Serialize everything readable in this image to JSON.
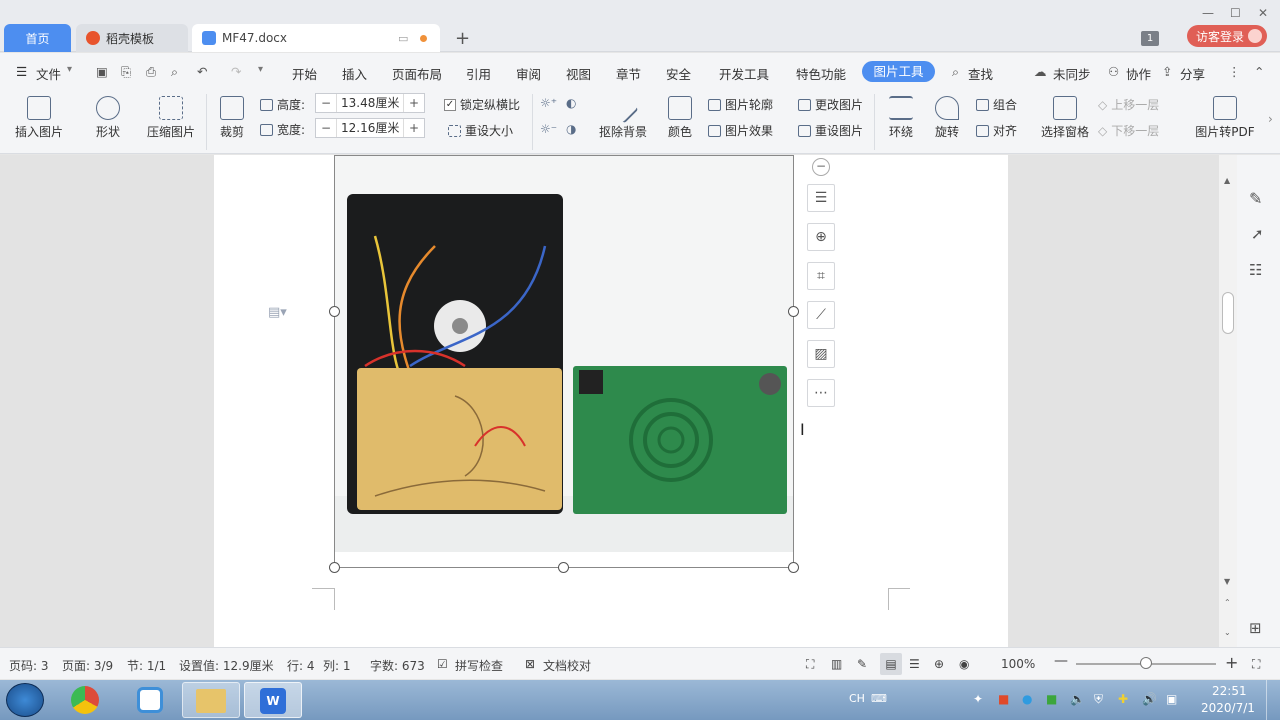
{
  "tabs": {
    "home": "首页",
    "wps": "稻壳模板",
    "doc": "MF47.docx"
  },
  "titlebar": {
    "badge": "1",
    "login": "访客登录"
  },
  "menu": {
    "file": "文件",
    "items": [
      "开始",
      "插入",
      "页面布局",
      "引用",
      "审阅",
      "视图",
      "章节",
      "安全",
      "开发工具",
      "特色功能"
    ],
    "active": "图片工具",
    "search": "查找",
    "sync": "未同步",
    "collab": "协作",
    "share": "分享"
  },
  "ribbon": {
    "insert_pic": "插入图片",
    "shape": "形状",
    "compress": "压缩图片",
    "crop": "裁剪",
    "height_label": "高度:",
    "height_value": "13.48厘米",
    "width_label": "宽度:",
    "width_value": "12.16厘米",
    "lock_ratio": "锁定纵横比",
    "reset_size": "重设大小",
    "remove_bg": "抠除背景",
    "color": "颜色",
    "outline": "图片轮廓",
    "effect": "图片效果",
    "change_pic": "更改图片",
    "reset_pic": "重设图片",
    "wrap": "环绕",
    "rotate": "旋转",
    "group": "组合",
    "align": "对齐",
    "selection_pane": "选择窗格",
    "bring_forward": "上移一层",
    "send_backward": "下移一层",
    "to_pdf": "图片转PDF"
  },
  "status": {
    "page_num": "页码: 3",
    "pages": "页面: 3/9",
    "section": "节: 1/1",
    "setting": "设置值: 12.9厘米",
    "row": "行: 4",
    "col": "列: 1",
    "words": "字数: 673",
    "spell": "拼写检查",
    "proof": "文档校对",
    "zoom": "100%"
  },
  "taskbar": {
    "ime": "CH",
    "time": "22:51",
    "date": "2020/7/1"
  }
}
